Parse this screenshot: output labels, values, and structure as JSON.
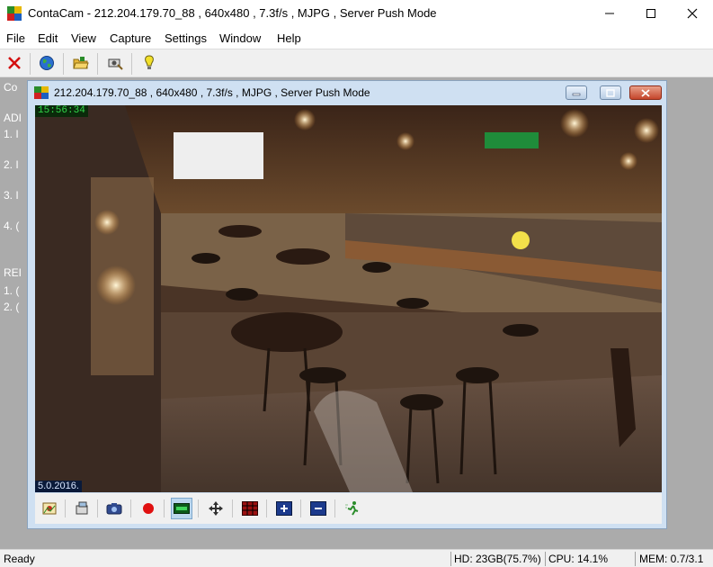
{
  "window": {
    "title": "ContaCam - 212.204.179.70_88 , 640x480 , 7.3f/s , MJPG , Server Push Mode",
    "controls": [
      "minimize-icon",
      "maximize-icon",
      "close-icon"
    ]
  },
  "menu": {
    "items": [
      "File",
      "Edit",
      "View",
      "Capture",
      "Settings",
      "Window",
      "Help"
    ]
  },
  "toolbar": {
    "buttons": [
      "close-red-x-icon",
      "globe-icon",
      "open-folder-icon",
      "camera-settings-icon",
      "tip-bulb-icon"
    ]
  },
  "background_text": {
    "lines": [
      "Co",
      "ADI",
      "1. I",
      "2. I",
      "3. I",
      "4. (",
      "REI",
      "1. (",
      "2. ("
    ]
  },
  "camera_window": {
    "title": "212.204.179.70_88 , 640x480 , 7.3f/s , MJPG , Server Push Mode",
    "timestamp": "15:56:34",
    "date": "5.0.2016.",
    "toolbar_buttons": [
      "snapshot-icon",
      "snapshot-settings-icon",
      "camera-icon",
      "record-icon",
      "detection-icon",
      "move-icon",
      "zone-icon",
      "zoom-in-icon",
      "zoom-out-icon",
      "motion-icon"
    ]
  },
  "status": {
    "ready": "Ready",
    "hd": "HD: 23GB(75.7%)",
    "cpu": "CPU: 14.1%",
    "mem": "MEM: 0.7/3.1"
  },
  "colors": {
    "mdi_background": "#ababab",
    "child_frame": "#cfe0f2",
    "overlay_time": "#32d64a",
    "record_red": "#e01010"
  }
}
